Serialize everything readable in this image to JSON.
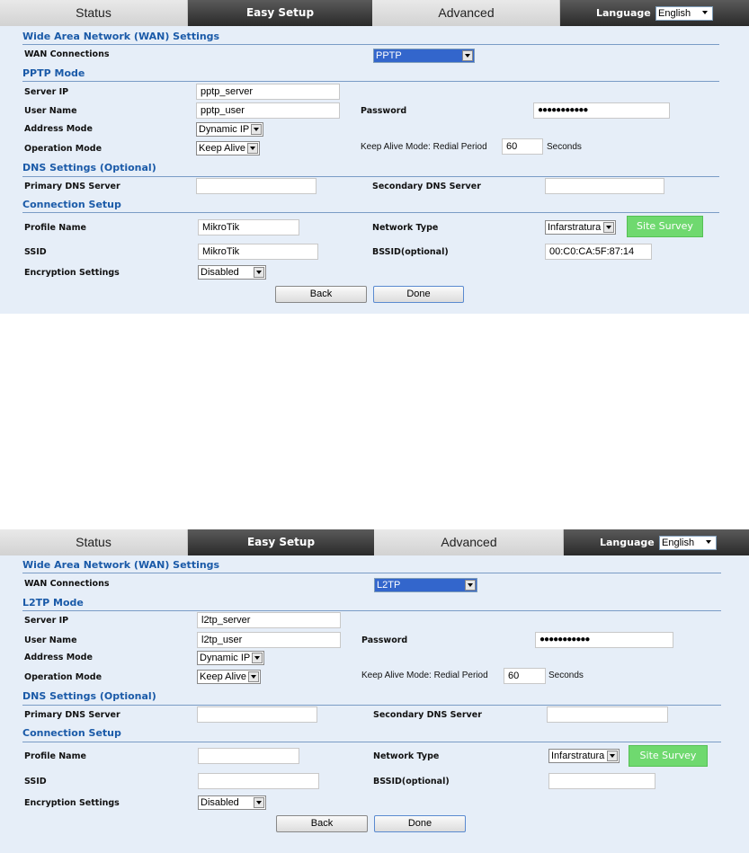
{
  "nav": {
    "tabs": [
      "Status",
      "Easy Setup",
      "Advanced"
    ],
    "language_label": "Language",
    "language_value": "English"
  },
  "panels": [
    {
      "wan_title": "Wide Area Network (WAN) Settings",
      "wan_connections_label": "WAN Connections",
      "wan_connection": "PPTP",
      "mode_title": "PPTP Mode",
      "server_ip_label": "Server IP",
      "server_ip": "pptp_server",
      "user_name_label": "User Name",
      "user_name": "pptp_user",
      "password_label": "Password",
      "password": "●●●●●●●●●●●",
      "address_mode_label": "Address Mode",
      "address_mode": "Dynamic IP",
      "operation_mode_label": "Operation Mode",
      "operation_mode": "Keep Alive",
      "keep_alive_label": "Keep Alive Mode: Redial Period",
      "redial_period": "60",
      "seconds_label": "Seconds",
      "dns_title": "DNS Settings (Optional)",
      "primary_dns_label": "Primary DNS Server",
      "primary_dns": "",
      "secondary_dns_label": "Secondary DNS Server",
      "secondary_dns": "",
      "conn_title": "Connection Setup",
      "profile_name_label": "Profile Name",
      "profile_name": "MikroTik",
      "network_type_label": "Network Type",
      "network_type": "Infarstratura",
      "site_survey": "Site Survey",
      "ssid_label": "SSID",
      "ssid": "MikroTik",
      "bssid_label": "BSSID(optional)",
      "bssid": "00:C0:CA:5F:87:14",
      "encryption_label": "Encryption Settings",
      "encryption": "Disabled",
      "back": "Back",
      "done": "Done"
    },
    {
      "wan_title": "Wide Area Network (WAN) Settings",
      "wan_connections_label": "WAN Connections",
      "wan_connection": "L2TP",
      "mode_title": "L2TP Mode",
      "server_ip_label": "Server IP",
      "server_ip": "l2tp_server",
      "user_name_label": "User Name",
      "user_name": "l2tp_user",
      "password_label": "Password",
      "password": "●●●●●●●●●●●",
      "address_mode_label": "Address Mode",
      "address_mode": "Dynamic IP",
      "operation_mode_label": "Operation Mode",
      "operation_mode": "Keep Alive",
      "keep_alive_label": "Keep Alive Mode: Redial Period",
      "redial_period": "60",
      "seconds_label": "Seconds",
      "dns_title": "DNS Settings (Optional)",
      "primary_dns_label": "Primary DNS Server",
      "primary_dns": "",
      "secondary_dns_label": "Secondary DNS Server",
      "secondary_dns": "",
      "conn_title": "Connection Setup",
      "profile_name_label": "Profile Name",
      "profile_name": "",
      "network_type_label": "Network Type",
      "network_type": "Infarstratura",
      "site_survey": "Site Survey",
      "ssid_label": "SSID",
      "ssid": "",
      "bssid_label": "BSSID(optional)",
      "bssid": "",
      "encryption_label": "Encryption Settings",
      "encryption": "Disabled",
      "back": "Back",
      "done": "Done"
    }
  ]
}
